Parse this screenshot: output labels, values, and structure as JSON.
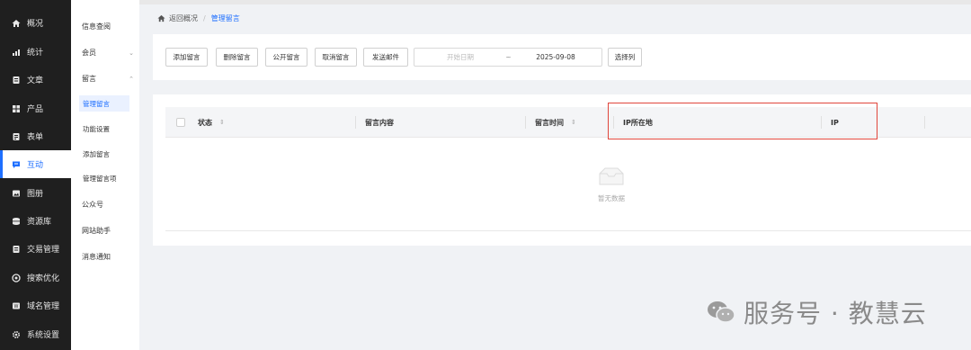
{
  "sidebar": {
    "items": [
      {
        "label": "概况",
        "icon": "home-icon",
        "active": false
      },
      {
        "label": "统计",
        "icon": "chart-icon",
        "active": false
      },
      {
        "label": "文章",
        "icon": "document-icon",
        "active": false
      },
      {
        "label": "产品",
        "icon": "grid-icon",
        "active": false
      },
      {
        "label": "表单",
        "icon": "form-icon",
        "active": false
      },
      {
        "label": "互动",
        "icon": "message-icon",
        "active": true
      },
      {
        "label": "图册",
        "icon": "album-icon",
        "active": false
      },
      {
        "label": "资源库",
        "icon": "database-icon",
        "active": false
      },
      {
        "label": "交易管理",
        "icon": "trade-icon",
        "active": false
      },
      {
        "label": "搜索优化",
        "icon": "search-optimize-icon",
        "active": false
      },
      {
        "label": "域名管理",
        "icon": "domain-icon",
        "active": false
      },
      {
        "label": "系统设置",
        "icon": "gear-icon",
        "active": false
      }
    ]
  },
  "subnav": {
    "info_query": "信息查阅",
    "member": "会员",
    "message": "留言",
    "message_children": [
      "管理留言",
      "功能设置",
      "添加留言",
      "管理留言项"
    ],
    "official_account": "公众号",
    "site_assistant": "网站助手",
    "notifications": "消息通知"
  },
  "breadcrumb": {
    "back": "返回概况",
    "separator": "/",
    "current": "管理留言"
  },
  "toolbar": {
    "buttons": [
      "添加留言",
      "删除留言",
      "公开留言",
      "取消留言",
      "发送邮件"
    ],
    "date_start_placeholder": "开始日期",
    "date_separator": "~",
    "date_end_value": "2025-09-08",
    "select_columns": "选择列"
  },
  "table": {
    "columns": [
      "状态",
      "留言内容",
      "留言时间",
      "IP所在地",
      "IP"
    ],
    "empty_text": "暂无数据"
  },
  "watermark": {
    "text": "服务号 · 教慧云"
  },
  "colors": {
    "accent": "#1e6fff",
    "sidebar_bg": "#1f1f1f",
    "highlight": "#e0463c"
  }
}
